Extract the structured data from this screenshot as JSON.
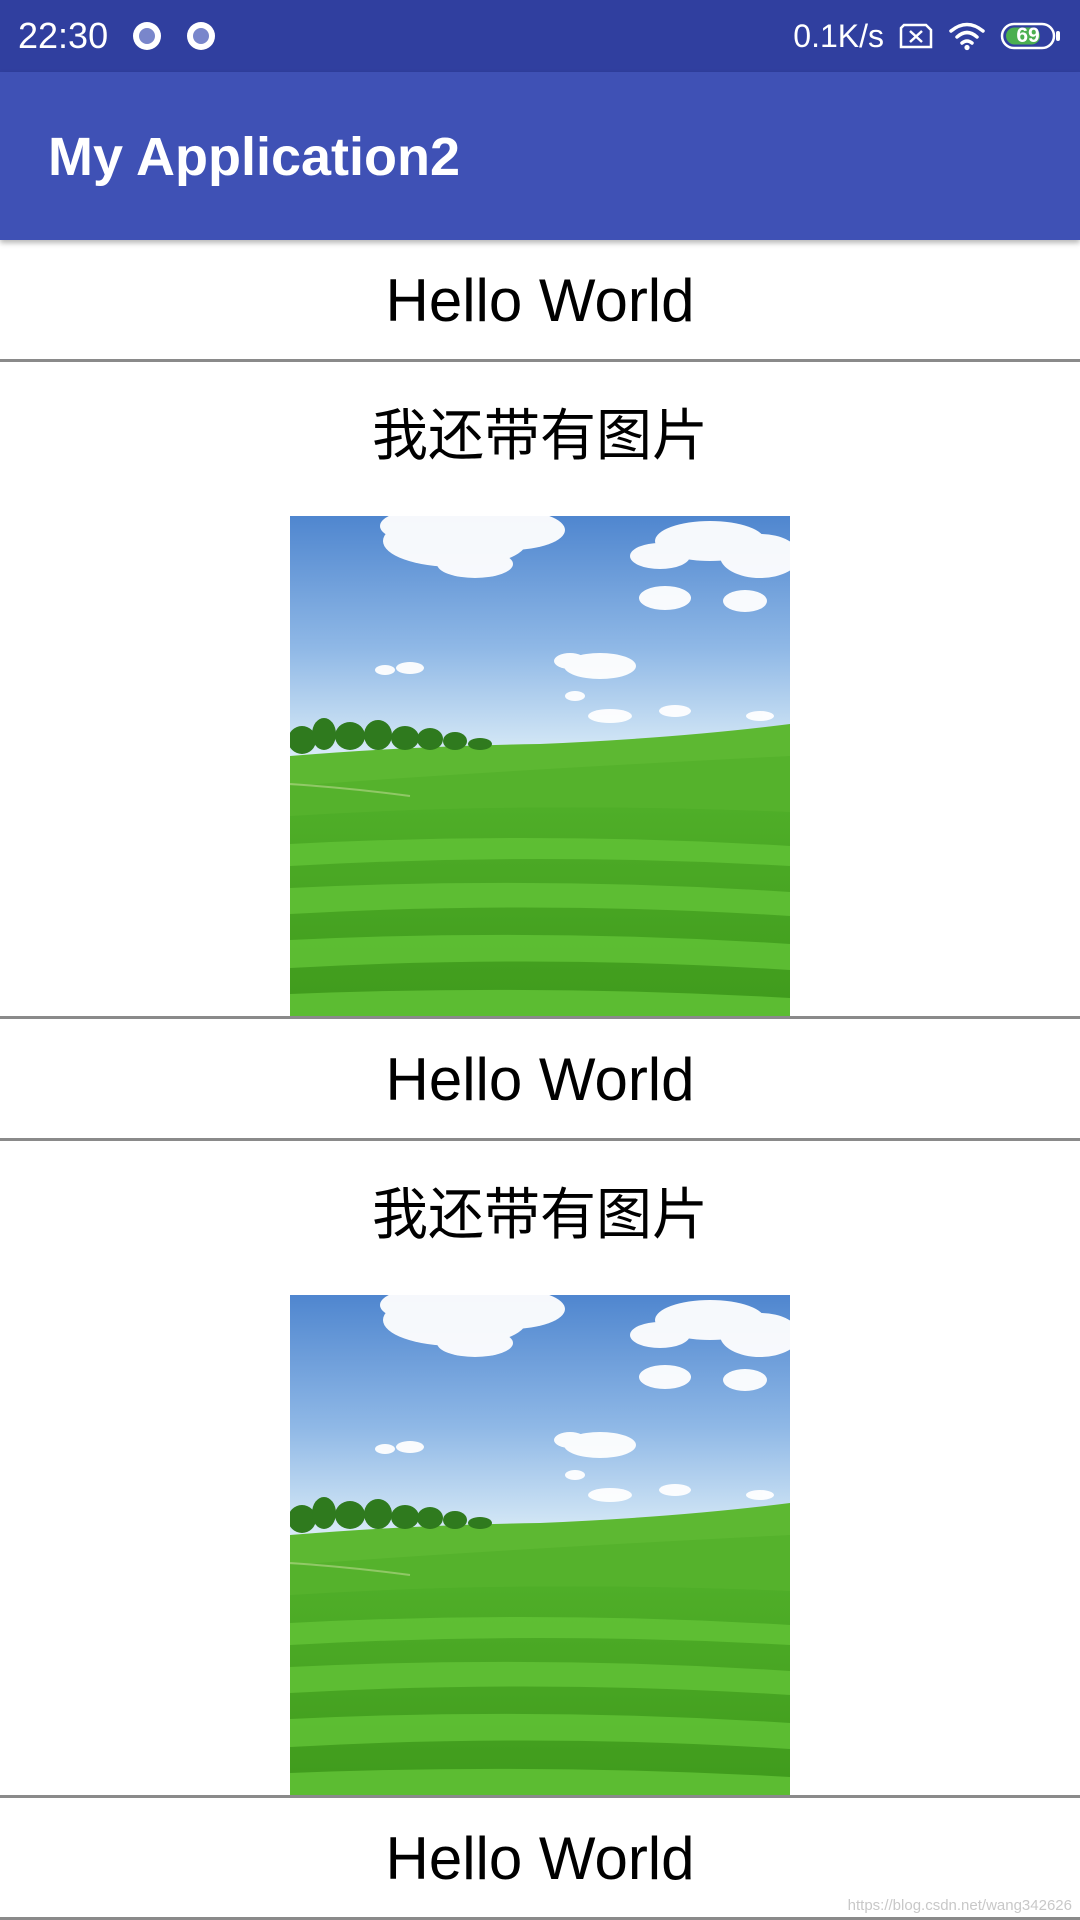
{
  "status_bar": {
    "time": "22:30",
    "net_speed": "0.1K/s",
    "battery_level": "69",
    "icons": [
      "notification-dot-icon",
      "notification-dot-icon",
      "sim-no-signal-icon",
      "wifi-icon",
      "battery-icon"
    ]
  },
  "app_bar": {
    "title": "My Application2",
    "color": "#3f51b5"
  },
  "list": {
    "items": [
      {
        "type": "text",
        "text": "Hello World"
      },
      {
        "type": "image",
        "caption": "我还带有图片",
        "image": "grass-field-sky-image"
      },
      {
        "type": "text",
        "text": "Hello World"
      },
      {
        "type": "image",
        "caption": "我还带有图片",
        "image": "grass-field-sky-image"
      },
      {
        "type": "text",
        "text": "Hello World"
      }
    ]
  },
  "watermark": "https://blog.csdn.net/wang342626"
}
